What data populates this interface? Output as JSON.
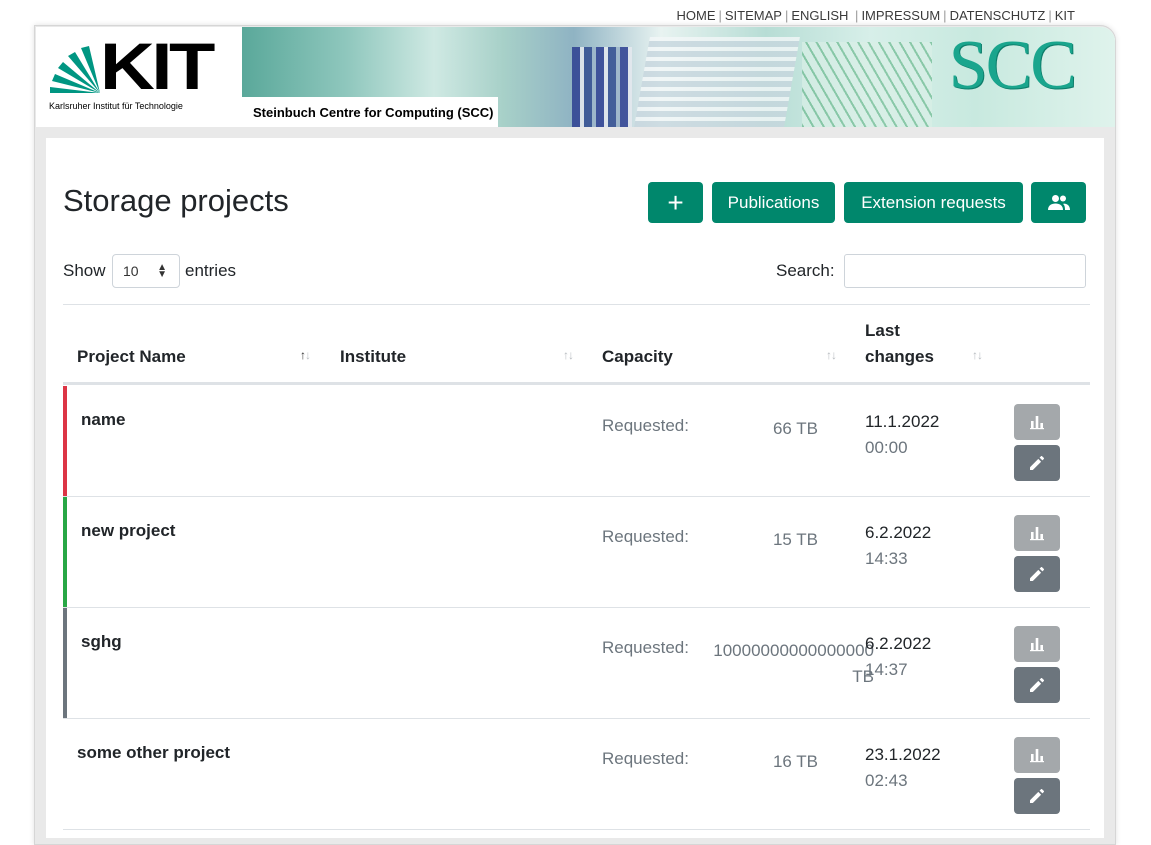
{
  "toplinks": [
    "HOME",
    "SITEMAP",
    "ENGLISH",
    "IMPRESSUM",
    "DATENSCHUTZ",
    "KIT"
  ],
  "header": {
    "logo_text": "KIT",
    "logo_subtitle": "Karlsruher Institut für Technologie",
    "banner_label": "Steinbuch Centre for Computing (SCC)",
    "banner_logo": "SCC"
  },
  "page": {
    "title": "Storage projects",
    "buttons": {
      "add_icon": "+",
      "publications": "Publications",
      "extension_requests": "Extension requests",
      "group_icon": "group-icon"
    }
  },
  "table_controls": {
    "show_label": "Show",
    "page_size": "10",
    "entries_label": "entries",
    "search_label": "Search:",
    "search_value": ""
  },
  "columns": {
    "project_name": "Project Name",
    "institute": "Institute",
    "capacity": "Capacity",
    "last_changes": "Last changes",
    "last_changes_line1": "Last",
    "last_changes_line2": "changes"
  },
  "colors": {
    "primary": "#00876c",
    "row_red": "#dc3545",
    "row_green": "#28a745",
    "row_grey": "#6c757d"
  },
  "rows": [
    {
      "name": "name",
      "institute": "",
      "capacity_label": "Requested:",
      "capacity": "66 TB",
      "date": "11.1.2022",
      "time": "00:00",
      "status_color": "#dc3545"
    },
    {
      "name": "new project",
      "institute": "",
      "capacity_label": "Requested:",
      "capacity": "15 TB",
      "date": "6.2.2022",
      "time": "14:33",
      "status_color": "#28a745"
    },
    {
      "name": "sghg",
      "institute": "",
      "capacity_label": "Requested:",
      "capacity": "10000000000000000 TB",
      "date": "6.2.2022",
      "time": "14:37",
      "status_color": "#6c757d"
    },
    {
      "name": "some other project",
      "institute": "",
      "capacity_label": "Requested:",
      "capacity": "16 TB",
      "date": "23.1.2022",
      "time": "02:43",
      "status_color": ""
    }
  ]
}
